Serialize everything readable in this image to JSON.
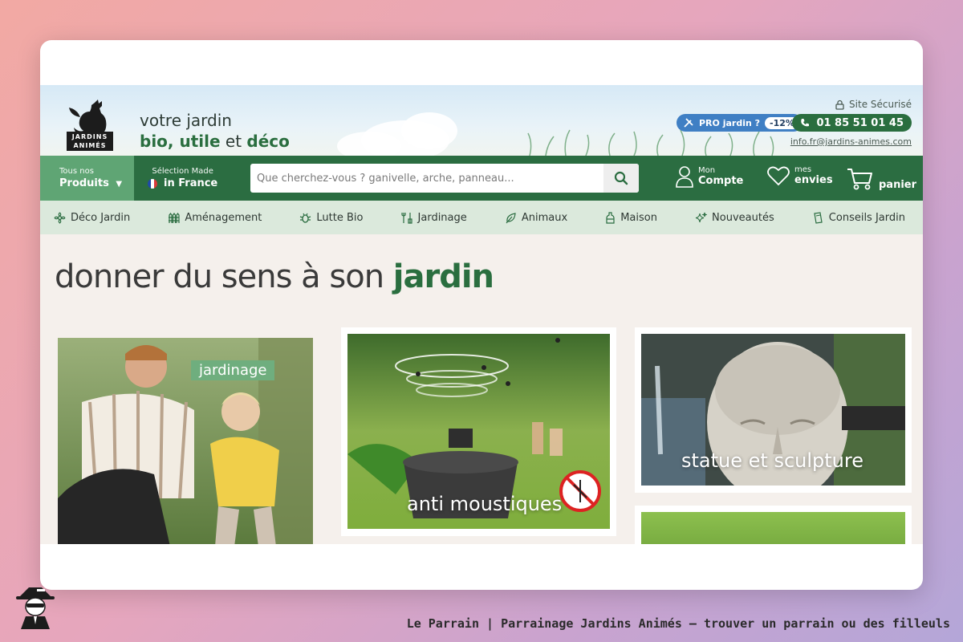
{
  "header": {
    "tagline_line1": "votre jardin",
    "tagline_bio": "bio, utile",
    "tagline_et": " et ",
    "tagline_deco": "déco",
    "logo_text_line1": "JARDINS",
    "logo_text_line2": "ANIMÉS",
    "pro_label": "PRO jardin ?",
    "pro_badge": "-12%",
    "secure": "Site Sécurisé",
    "phone": "01 85 51 01 45",
    "email": "info.fr@jardins-animes.com"
  },
  "nav": {
    "produits_small": "Tous nos",
    "produits_big": "Produits",
    "selection_small": "Sélection Made",
    "selection_big": "in France",
    "search_placeholder": "Que cherchez-vous ? ganivelle, arche, panneau...",
    "account_small": "Mon",
    "account_big": "Compte",
    "wishlist_small": "mes",
    "wishlist_big": "envies",
    "cart_big": "panier"
  },
  "categories": [
    {
      "label": "Déco Jardin",
      "icon": "flower-icon"
    },
    {
      "label": "Aménagement",
      "icon": "fence-icon"
    },
    {
      "label": "Lutte Bio",
      "icon": "bug-icon"
    },
    {
      "label": "Jardinage",
      "icon": "tools-icon"
    },
    {
      "label": "Animaux",
      "icon": "feather-icon"
    },
    {
      "label": "Maison",
      "icon": "bottle-icon"
    },
    {
      "label": "Nouveautés",
      "icon": "sparkle-icon"
    },
    {
      "label": "Conseils Jardin",
      "icon": "book-icon"
    }
  ],
  "main": {
    "headline_plain": "donner du sens à son ",
    "headline_bold": "jardin",
    "cards": [
      {
        "label": "jardinage"
      },
      {
        "label": "anti moustiques"
      },
      {
        "label": "statue et sculpture"
      }
    ]
  },
  "caption": "Le Parrain | Parrainage Jardins Animés — trouver un parrain ou des filleuls",
  "colors": {
    "brand_green": "#2b6d41",
    "light_green": "#5fa574",
    "category_bg": "#dbe9dc",
    "pro_blue": "#3f7fc4"
  }
}
